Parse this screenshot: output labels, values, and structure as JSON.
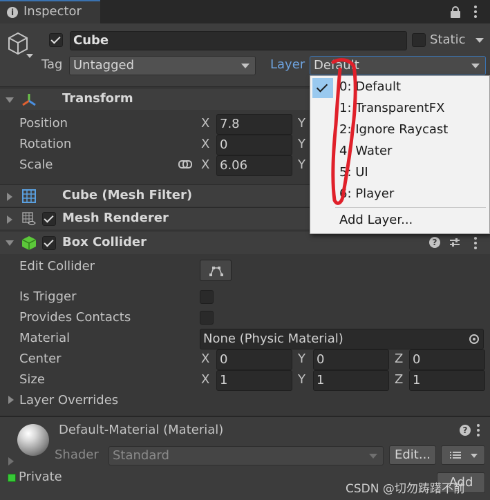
{
  "tab": {
    "title": "Inspector"
  },
  "object": {
    "name": "Cube",
    "static_label": "Static",
    "tag_label": "Tag",
    "tag_value": "Untagged",
    "layer_label": "Layer",
    "layer_value": "Default"
  },
  "transform": {
    "title": "Transform",
    "rows": [
      {
        "label": "Position",
        "x_axis": "X",
        "x": "7.8",
        "y_axis": "Y"
      },
      {
        "label": "Rotation",
        "x_axis": "X",
        "x": "0",
        "y_axis": "Y"
      },
      {
        "label": "Scale",
        "x_axis": "X",
        "x": "6.06",
        "y_axis": "Y"
      }
    ]
  },
  "components": {
    "mesh_filter": "Cube (Mesh Filter)",
    "mesh_renderer": "Mesh Renderer",
    "box_collider": "Box Collider"
  },
  "box_collider": {
    "edit_collider": "Edit Collider",
    "is_trigger": "Is Trigger",
    "provides_contacts": "Provides Contacts",
    "material_label": "Material",
    "material_value": "None (Physic Material)",
    "center_label": "Center",
    "center": {
      "x": "0",
      "y": "0",
      "z": "0"
    },
    "size_label": "Size",
    "size": {
      "x": "1",
      "y": "1",
      "z": "1"
    },
    "axes": {
      "x": "X",
      "y": "Y",
      "z": "Z"
    },
    "layer_overrides": "Layer Overrides"
  },
  "material": {
    "name": "Default-Material (Material)",
    "shader_label": "Shader",
    "shader_value": "Standard",
    "edit_label": "Edit...",
    "private_label": "Private",
    "add_label": "Add"
  },
  "layer_menu": {
    "items": [
      "0: Default",
      "1: TransparentFX",
      "2: Ignore Raycast",
      "4: Water",
      "5: UI",
      "6: Player"
    ],
    "selected_index": 0,
    "add_layer": "Add Layer..."
  },
  "watermark": "CSDN @切勿踌躇不前",
  "colors": {
    "accent": "#3a72b0",
    "panel": "#383838",
    "field": "#2a2a2a",
    "highlight": "#99c9ef",
    "annotation": "#e0202a"
  }
}
